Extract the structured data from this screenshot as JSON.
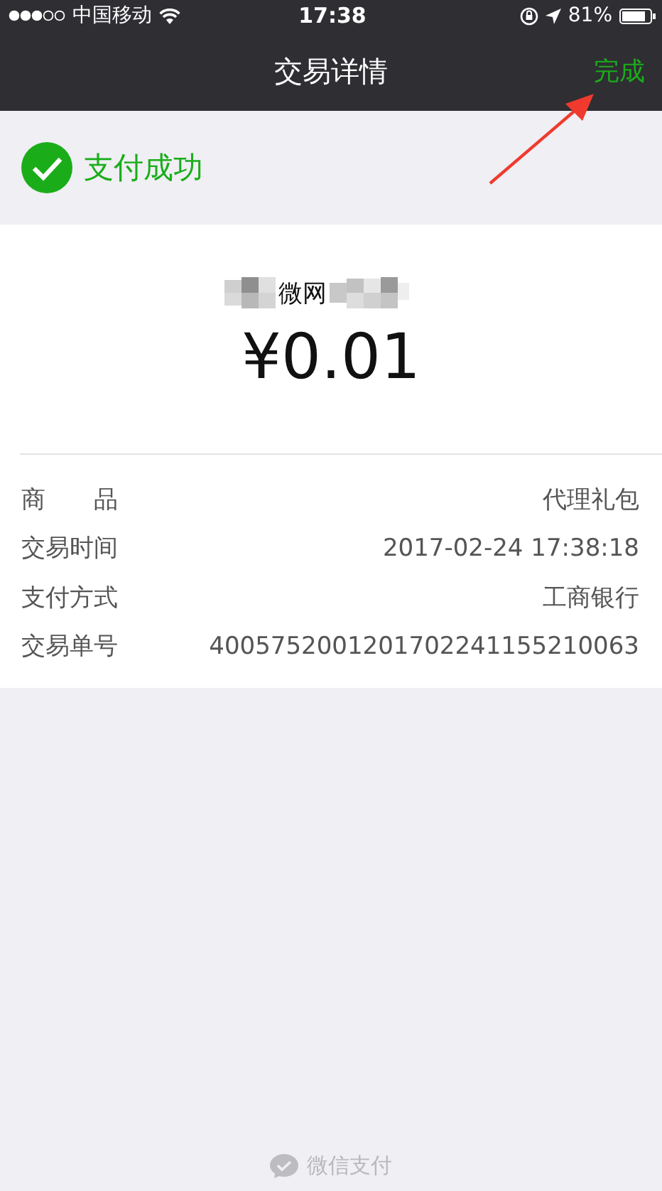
{
  "status_bar": {
    "carrier": "中国移动",
    "time": "17:38",
    "battery": "81%"
  },
  "nav": {
    "title": "交易详情",
    "done": "完成"
  },
  "banner": {
    "text": "支付成功"
  },
  "payment": {
    "merchant": "微网",
    "amount": "¥0.01"
  },
  "details": [
    {
      "label": "商　　品",
      "value": "代理礼包"
    },
    {
      "label": "交易时间",
      "value": "2017-02-24 17:38:18"
    },
    {
      "label": "支付方式",
      "value": "工商银行"
    },
    {
      "label": "交易单号",
      "value": "4005752001201702241155210063"
    }
  ],
  "footer": {
    "text": "微信支付"
  }
}
